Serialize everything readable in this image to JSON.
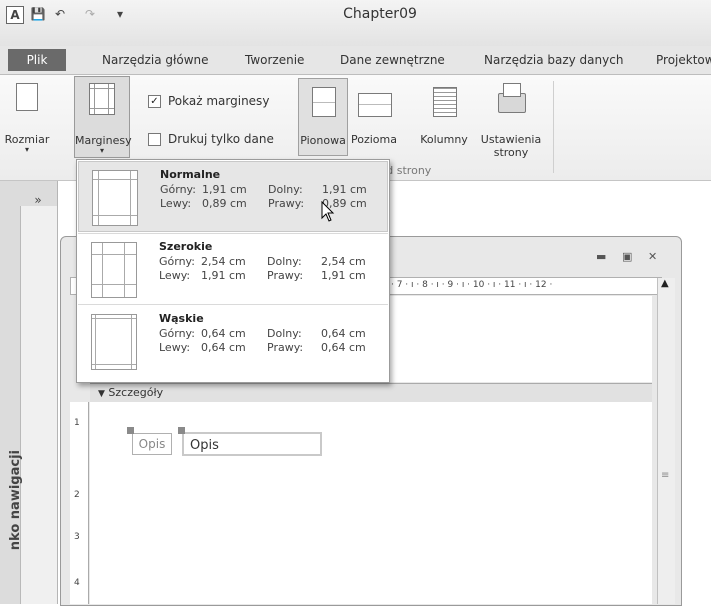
{
  "window": {
    "title": "Chapter09"
  },
  "tabs": [
    "Plik",
    "Narzędzia główne",
    "Tworzenie",
    "Dane zewnętrzne",
    "Narzędzia bazy danych",
    "Projektow"
  ],
  "ribbon": {
    "size_label": "Rozmiar",
    "margins_label": "Marginesy",
    "show_margins_label": "Pokaż marginesy",
    "print_data_only_label": "Drukuj tylko dane",
    "portrait_label": "Pionowa",
    "landscape_label": "Pozioma",
    "columns_label": "Kolumny",
    "page_setup_label_1": "Ustawienia",
    "page_setup_label_2": "strony",
    "group_label": "Układ strony"
  },
  "margins_menu": {
    "options": [
      {
        "name": "Normalne",
        "top_label": "Górny:",
        "top": "1,91 cm",
        "bottom_label": "Dolny:",
        "bottom": "1,91 cm",
        "left_label": "Lewy:",
        "left": "0,89 cm",
        "right_label": "Prawy:",
        "right": "0,89 cm"
      },
      {
        "name": "Szerokie",
        "top_label": "Górny:",
        "top": "2,54 cm",
        "bottom_label": "Dolny:",
        "bottom": "2,54 cm",
        "left_label": "Lewy:",
        "left": "1,91 cm",
        "right_label": "Prawy:",
        "right": "1,91 cm"
      },
      {
        "name": "Wąskie",
        "top_label": "Górny:",
        "top": "0,64 cm",
        "bottom_label": "Dolny:",
        "bottom": "0,64 cm",
        "left_label": "Lewy:",
        "left": "0,64 cm",
        "right_label": "Prawy:",
        "right": "0,64 cm"
      }
    ]
  },
  "nav_pane": {
    "toggle": "»",
    "label": "nko nawigacji"
  },
  "form": {
    "section_label": "Szczegóły",
    "label_text": "Opis",
    "textbox_text": "Opis",
    "ruler_text": "· 7 · ı · 8 · ı · 9 · ı · 10 · ı · 11 · ı · 12 ·",
    "vruler_marks": [
      "1",
      "2",
      "3",
      "4"
    ]
  },
  "colors": {
    "tab_file_bg": "#6a6a6a",
    "selected_option_bg": "#e6e6e6"
  }
}
